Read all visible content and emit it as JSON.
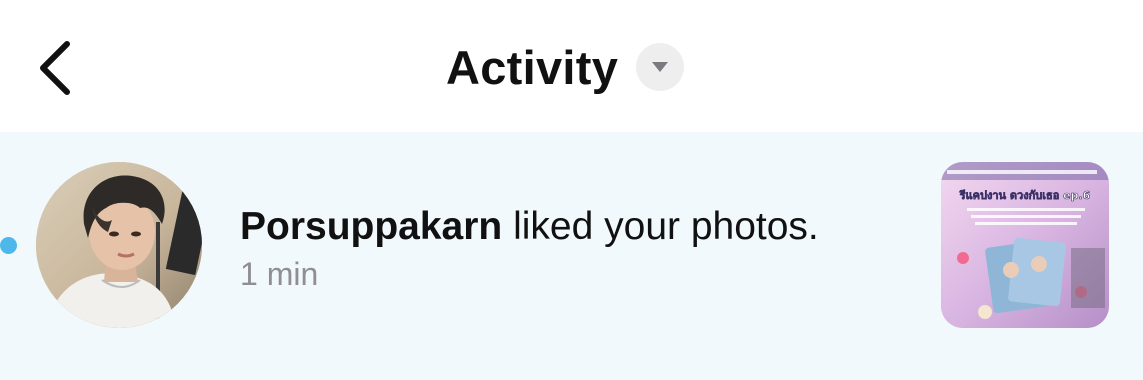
{
  "header": {
    "back_icon": "chevron-left-icon",
    "title": "Activity",
    "dropdown_icon": "caret-down-icon"
  },
  "notification": {
    "unread": true,
    "username": "Porsuppakarn",
    "action": "liked your photos.",
    "timestamp": "1 min",
    "thumbnail_caption": "รีแคปงาน ดวงกับเธอ ep.6"
  },
  "colors": {
    "row_background": "#f1f9fd",
    "unread_dot": "#4fb8ea",
    "secondary_text": "#8e8e93"
  }
}
